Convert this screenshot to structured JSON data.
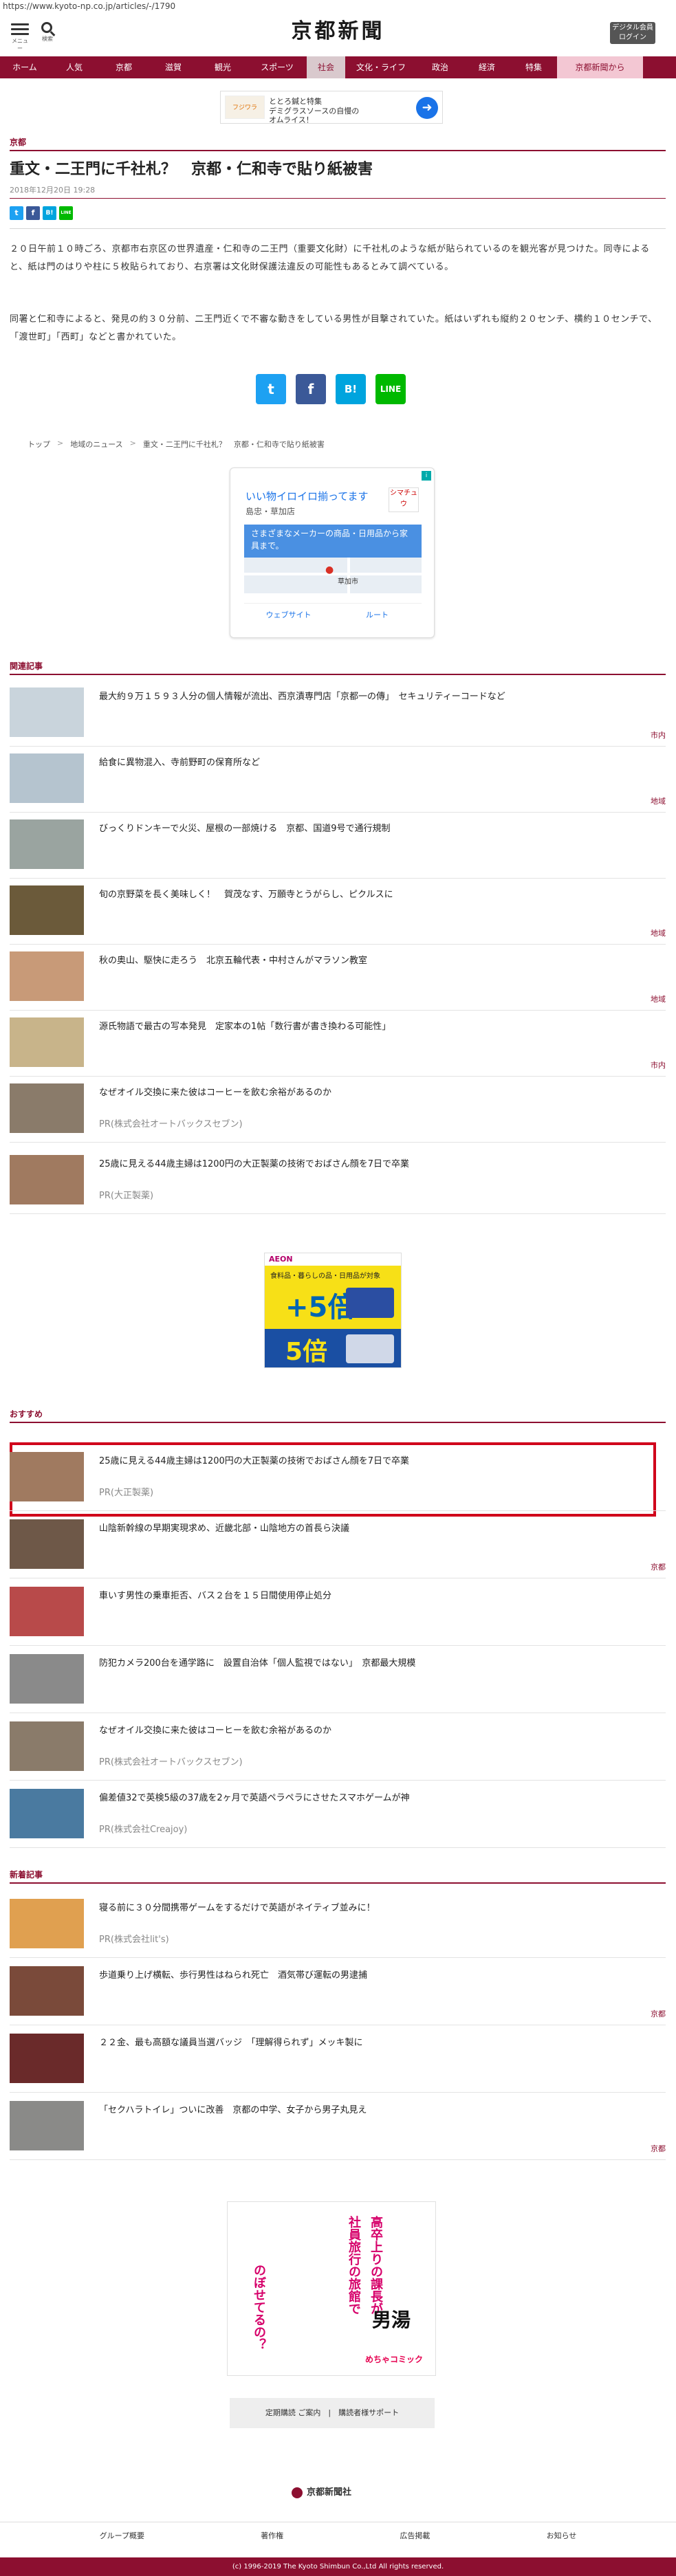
{
  "browser": {
    "url": "https://www.kyoto-np.co.jp/articles/-/1790"
  },
  "header": {
    "menu_label": "メニュー",
    "search_label": "検索",
    "logo": "京都新聞",
    "login_line1": "デジタル会員",
    "login_line2": "ログイン"
  },
  "nav": [
    {
      "label": "ホーム"
    },
    {
      "label": "人気"
    },
    {
      "label": "京都"
    },
    {
      "label": "滋賀"
    },
    {
      "label": "観光"
    },
    {
      "label": "スポーツ"
    },
    {
      "label": "社会"
    },
    {
      "label": "文化・ライフ"
    },
    {
      "label": "政治"
    },
    {
      "label": "経済"
    },
    {
      "label": "特集"
    },
    {
      "label": "京都新聞から"
    }
  ],
  "top_ad": {
    "thumb": "フジワラ",
    "line1": "ととろ鍼と特集",
    "line2": "デミグラスソースの自慢の",
    "line3": "オムライス！"
  },
  "article": {
    "section": "京都",
    "title": "重文・二王門に千社札？　京都・仁和寺で貼り紙被害",
    "date": "2018年12月20日 19:28",
    "para1": "２０日午前１０時ごろ、京都市右京区の世界遺産・仁和寺の二王門（重要文化財）に千社札のような紙が貼られているのを観光客が見つけた。同寺によると、紙は門のはりや柱に５枚貼られており、右京署は文化財保護法違反の可能性もあるとみて調べている。",
    "para2": "同署と仁和寺によると、発見の約３０分前、二王門近くで不審な動きをしている男性が目撃されていた。紙はいずれも縦約２０センチ、横約１０センチで、「渡世町」「西町」などと書かれていた。"
  },
  "share": {
    "twitter": "t",
    "facebook": "f",
    "hatena": "B!",
    "line": "LINE"
  },
  "breadcrumb": [
    "トップ",
    "地域のニュース",
    "重文・二王門に千社札？　京都・仁和寺で貼り紙被害"
  ],
  "map_ad": {
    "headline": "いい物イロイロ揃ってます",
    "store": "島忠・草加店",
    "banner": "さまざまなメーカーの商品・日用品から家具まで。",
    "place": "草加市",
    "logo": "シマチュウ",
    "website": "ウェブサイト",
    "route": "ルート"
  },
  "related": {
    "label": "関連記事",
    "items": [
      {
        "title": "最大約９万１５９３人分の個人情報が流出、西京漬専門店「京都一の傳」　セキュリティーコードなど",
        "category": "市内",
        "thumb": "#c9d4dc"
      },
      {
        "title": "給食に異物混入、寺前野町の保育所など",
        "category": "地域",
        "thumb": "#b5c4cf"
      },
      {
        "title": "びっくりドンキーで火災、屋根の一部焼ける　京都、国道9号で通行規制",
        "category": "",
        "thumb": "#9aa4a0"
      },
      {
        "title": "旬の京野菜を長く美味しく！　賀茂なす、万願寺とうがらし、ピクルスに",
        "category": "地域",
        "thumb": "#6b5a3a"
      },
      {
        "title": "秋の奥山、駆快に走ろう　北京五輪代表・中村さんがマラソン教室",
        "category": "地域",
        "thumb": "#c89a78"
      },
      {
        "title": "源氏物語で最古の写本発見　定家本の1帖「数行書が書き換わる可能性」",
        "category": "市内",
        "thumb": "#c8b48a"
      }
    ],
    "pr_items": [
      {
        "title": "なぜオイル交換に来た彼はコーヒーを飲む余裕があるのか",
        "sponsor": "PR(株式会社オートバックスセブン)",
        "thumb": "#8a7b6a"
      },
      {
        "title": "25歳に見える44歳主婦は1200円の大正製薬の技術でおばさん顔を7日で卒業",
        "sponsor": "PR(大正製薬)",
        "thumb": "#a07a60"
      }
    ]
  },
  "aeon_ad": {
    "brand": "AEON",
    "line1": "食料品・暮らしの品・日用品が対象",
    "big1": "+5倍",
    "big2": "5倍"
  },
  "recommended": {
    "label": "おすすめ",
    "items": [
      {
        "title": "25歳に見える44歳主婦は1200円の大正製薬の技術でおばさん顔を7日で卒業",
        "sponsor": "PR(大正製薬)",
        "category": "",
        "thumb": "#a07a60"
      },
      {
        "title": "山陰新幹線の早期実現求め、近畿北部・山陰地方の首長ら決議",
        "sponsor": "",
        "category": "京都",
        "thumb": "#6e5848"
      },
      {
        "title": "車いす男性の乗車拒否、バス２台を１５日間使用停止処分",
        "sponsor": "",
        "category": "",
        "thumb": "#b84a4a"
      },
      {
        "title": "防犯カメラ200台を通学路に　設置自治体「個人監視ではない」　京都最大規模",
        "sponsor": "",
        "category": "",
        "thumb": "#8a8a8a"
      },
      {
        "title": "なぜオイル交換に来た彼はコーヒーを飲む余裕があるのか",
        "sponsor": "PR(株式会社オートバックスセブン)",
        "category": "",
        "thumb": "#8a7b6a"
      },
      {
        "title": "偏差値32で英検5級の37歳を2ヶ月で英語ペラペラにさせたスマホゲームが神",
        "sponsor": "PR(株式会社Creajoy)",
        "category": "",
        "thumb": "#4a7aa0"
      }
    ]
  },
  "latest": {
    "label": "新着記事",
    "items": [
      {
        "title": "寝る前に３０分間携帯ゲームをするだけで英語がネイティブ並みに！",
        "sponsor": "PR(株式会社lit's)",
        "category": "",
        "thumb": "#e0a050"
      },
      {
        "title": "歩道乗り上げ横転、歩行男性はねられ死亡　酒気帯び運転の男逮捕",
        "sponsor": "",
        "category": "京都",
        "thumb": "#7a4a3a"
      },
      {
        "title": "２２金、最も高額な議員当選バッジ　「理解得られず」メッキ製に",
        "sponsor": "",
        "category": "",
        "thumb": "#6a2a2a"
      },
      {
        "title": "「セクハラトイレ」ついに改善　京都の中学、女子から男子丸見え",
        "sponsor": "",
        "category": "京都",
        "thumb": "#8a8a88"
      }
    ]
  },
  "manga_ad": {
    "t1": "社員旅行の旅館で",
    "t2": "高卒上りの課長が",
    "t3": "のぼせてるの？",
    "t4": "男湯",
    "t5": "めちゃコミック"
  },
  "footer": {
    "subscribe": "定期購読 ご案内　|　購読者様サポート",
    "logo": "京都新聞社",
    "links": [
      "グループ概要",
      "著作権",
      "広告掲載",
      "お知らせ"
    ],
    "copyright": "(c) 1996-2019 The Kyoto Shimbun Co.,Ltd All rights reserved."
  },
  "colors": {
    "brand": "#8c0f30",
    "twitter": "#1da1f2",
    "facebook": "#3b5998",
    "hatena": "#00a4de",
    "line": "#00b900",
    "highlight": "#d0021b"
  }
}
